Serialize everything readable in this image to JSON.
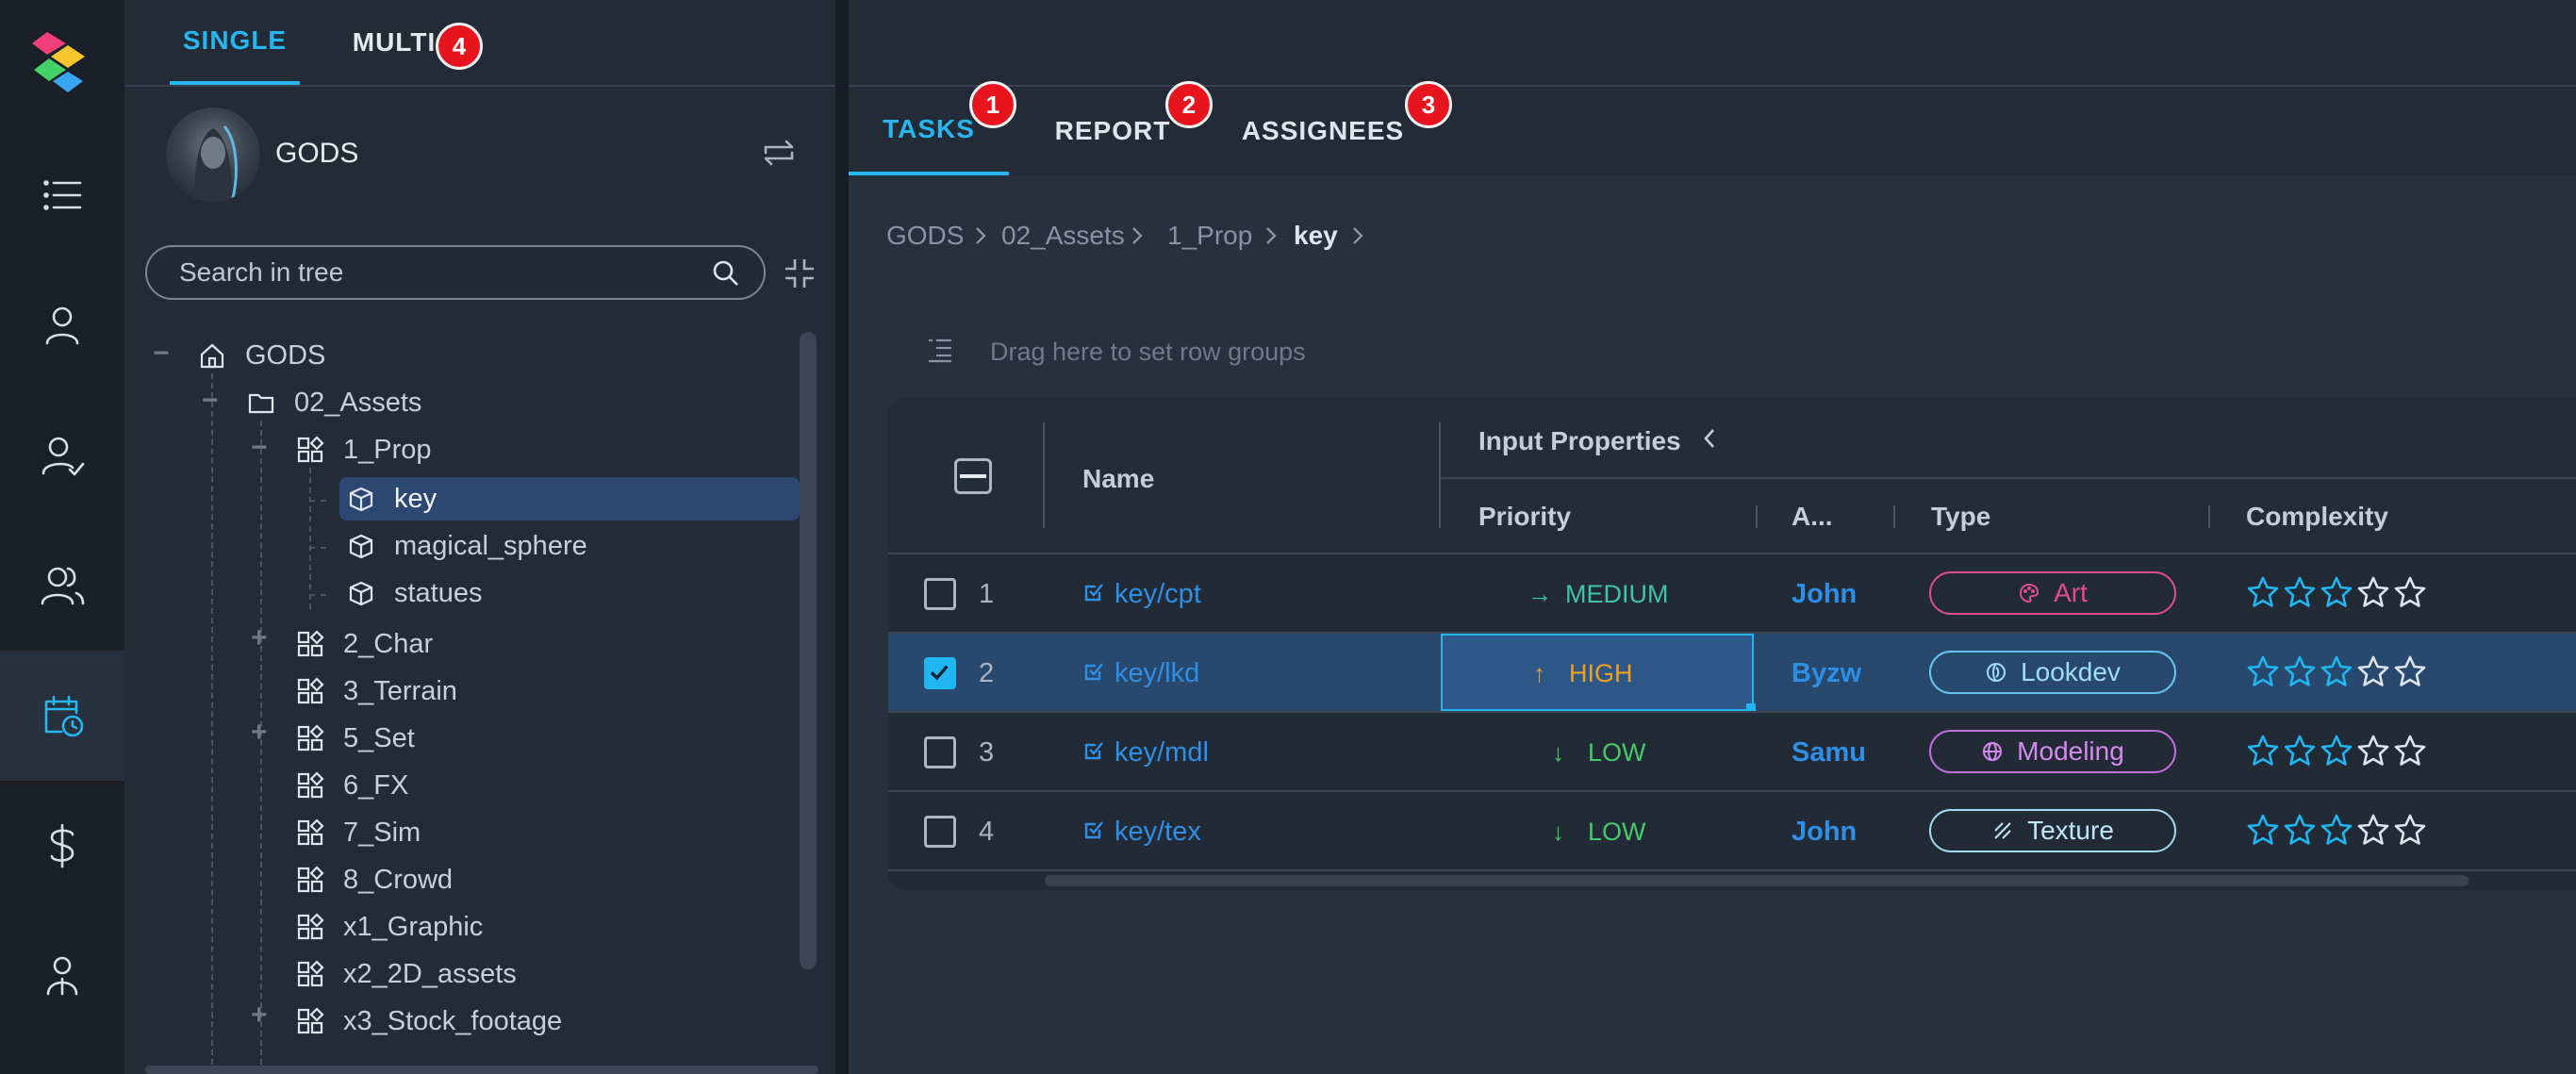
{
  "mode_tabs": {
    "single": "SINGLE",
    "multi": "MULTI",
    "multi_badge": "4"
  },
  "project": {
    "name": "GODS"
  },
  "search": {
    "placeholder": "Search in tree"
  },
  "tree": [
    {
      "label": "GODS",
      "icon": "home-icon",
      "expander": "−"
    },
    {
      "label": "02_Assets",
      "icon": "folder-icon",
      "expander": "−"
    },
    {
      "label": "1_Prop",
      "icon": "category-icon",
      "expander": "−"
    },
    {
      "label": "key",
      "icon": "cube-icon",
      "selected": true
    },
    {
      "label": "magical_sphere",
      "icon": "cube-icon"
    },
    {
      "label": "statues",
      "icon": "cube-icon"
    },
    {
      "label": "2_Char",
      "icon": "category-icon",
      "expander": "+"
    },
    {
      "label": "3_Terrain",
      "icon": "category-icon"
    },
    {
      "label": "5_Set",
      "icon": "category-icon",
      "expander": "+"
    },
    {
      "label": "6_FX",
      "icon": "category-icon"
    },
    {
      "label": "7_Sim",
      "icon": "category-icon"
    },
    {
      "label": "8_Crowd",
      "icon": "category-icon"
    },
    {
      "label": "x1_Graphic",
      "icon": "category-icon"
    },
    {
      "label": "x2_2D_assets",
      "icon": "category-icon"
    },
    {
      "label": "x3_Stock_footage",
      "icon": "category-icon",
      "expander": "+"
    }
  ],
  "main_tabs": [
    {
      "label": "TASKS",
      "badge": "1",
      "active": true
    },
    {
      "label": "REPORT",
      "badge": "2"
    },
    {
      "label": "ASSIGNEES",
      "badge": "3"
    }
  ],
  "breadcrumb": [
    "GODS",
    "02_Assets",
    "1_Prop",
    "key"
  ],
  "row_group_hint": "Drag here to set row groups",
  "grid": {
    "group_header": "Input Properties",
    "columns": {
      "name": "Name",
      "priority": "Priority",
      "assignee": "A...",
      "type": "Type",
      "complexity": "Complexity"
    },
    "rows": [
      {
        "num": "1",
        "name": "key/cpt",
        "priority": "MEDIUM",
        "priority_arrow": "→",
        "priority_color": "#3fc3a8",
        "assignee": "John",
        "type": "Art",
        "type_color": "#e04d8a",
        "type_icon": "palette-icon",
        "complexity": 3,
        "checked": false
      },
      {
        "num": "2",
        "name": "key/lkd",
        "priority": "HIGH",
        "priority_arrow": "↑",
        "priority_color": "#f0a020",
        "assignee": "Byzw",
        "type": "Lookdev",
        "type_color": "#67c6ee",
        "type_icon": "lookdev-icon",
        "complexity": 3,
        "checked": true
      },
      {
        "num": "3",
        "name": "key/mdl",
        "priority": "LOW",
        "priority_arrow": "↓",
        "priority_color": "#45c96a",
        "assignee": "Samu",
        "type": "Modeling",
        "type_color": "#c26fe0",
        "type_icon": "globe-icon",
        "complexity": 3,
        "checked": false
      },
      {
        "num": "4",
        "name": "key/tex",
        "priority": "LOW",
        "priority_arrow": "↓",
        "priority_color": "#45c96a",
        "assignee": "John",
        "type": "Texture",
        "type_color": "#9fdcf0",
        "type_icon": "texture-icon",
        "complexity": 3,
        "checked": false
      }
    ]
  },
  "colors": {
    "accent": "#27b6f0",
    "badge": "#e8141e",
    "link": "#2e8fe6"
  }
}
